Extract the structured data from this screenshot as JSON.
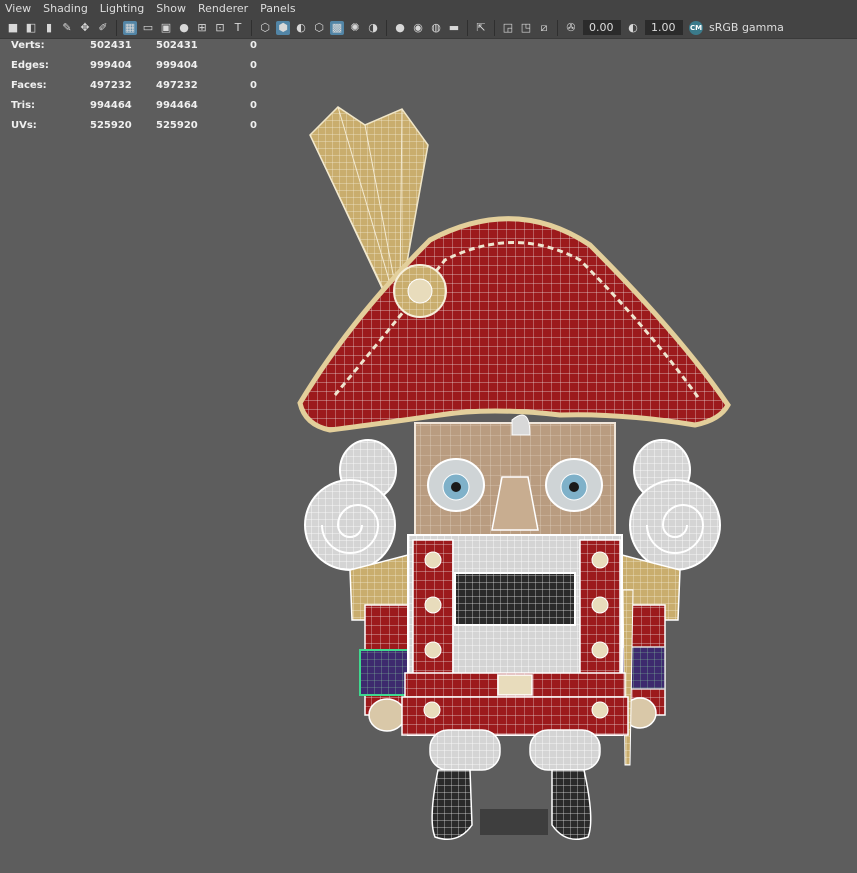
{
  "menu": {
    "items": [
      "View",
      "Shading",
      "Lighting",
      "Show",
      "Renderer",
      "Panels"
    ]
  },
  "toolbar": {
    "exposure_value": "0.00",
    "gamma_value": "1.00",
    "color_management_badge": "CM",
    "color_space_label": "sRGB gamma",
    "icons": [
      "camera-select-icon",
      "camera-attributes-icon",
      "bookmark-icon",
      "image-plane-icon",
      "grid-icon",
      "film-gate-icon",
      "resolution-gate-icon",
      "gate-mask-icon",
      "field-chart-icon",
      "safe-action-icon",
      "safe-title-icon",
      "wireframe-icon",
      "smooth-shade-icon",
      "default-material-icon",
      "bounding-box-icon",
      "wireframe-on-shaded-icon",
      "xray-icon",
      "use-lights-icon",
      "shadows-icon",
      "ambient-occlusion-icon",
      "motion-blur-icon",
      "anti-alias-icon",
      "depth-of-field-icon",
      "isolate-select-icon",
      "xray-joints-icon",
      "textured-icon",
      "exposure-icon",
      "gamma-icon",
      "color-management-icon"
    ]
  },
  "hud": {
    "rows": [
      {
        "label": "Verts:",
        "v1": "502431",
        "v2": "502431",
        "v3": "0"
      },
      {
        "label": "Edges:",
        "v1": "999404",
        "v2": "999404",
        "v3": "0"
      },
      {
        "label": "Faces:",
        "v1": "497232",
        "v2": "497232",
        "v3": "0"
      },
      {
        "label": "Tris:",
        "v1": "994464",
        "v2": "994464",
        "v3": "0"
      },
      {
        "label": "UVs:",
        "v1": "525920",
        "v2": "525920",
        "v3": "0"
      }
    ]
  },
  "colors": {
    "viewport_bg": "#5d5d5d",
    "toolbar_bg": "#444444",
    "hat_red": "#9c1a1c",
    "trim_gold": "#d8c08a",
    "wood_face": "#b89a7e",
    "wire_white": "#e8e8e8"
  }
}
